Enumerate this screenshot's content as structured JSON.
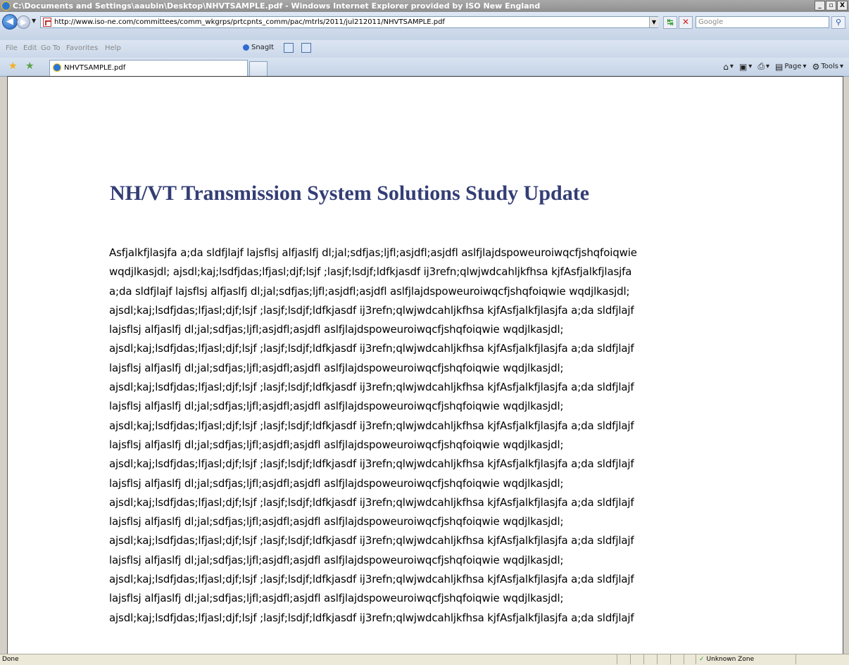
{
  "window": {
    "title": "C:\\Documents and Settings\\aaubin\\Desktop\\NHVTSAMPLE.pdf - Windows Internet Explorer provided by ISO New England",
    "controls": {
      "minimize": "_",
      "maximize": "▫",
      "close": "X"
    }
  },
  "address": {
    "url": "http://www.iso-ne.com/committees/comm_wkgrps/prtcpnts_comm/pac/mtrls/2011/jul212011/NHVTSAMPLE.pdf",
    "search_placeholder": "Google"
  },
  "menu": {
    "items": [
      "File",
      "Edit",
      "Go To",
      "Favorites",
      "Help"
    ],
    "snagit_label": "SnagIt"
  },
  "tab": {
    "label": "NHVTSAMPLE.pdf"
  },
  "command_bar": {
    "page_label": "Page",
    "tools_label": "Tools"
  },
  "document": {
    "title": "NH/VT Transmission System Solutions Study Update",
    "lines": [
      "Asfjalkfjlasjfa a;da sldfjlajf lajsflsj alfjaslfj dl;jal;sdfjas;ljfl;asjdfl;asjdfl aslfjlajdspoweuroiwqcfjshqfoiqwie",
      "wqdjlkasjdl; ajsdl;kaj;lsdfjdas;lfjasl;djf;lsjf ;lasjf;lsdjf;ldfkjasdf ij3refn;qlwjwdcahljkfhsa kjfAsfjalkfjlasjfa",
      "a;da sldfjlajf lajsflsj alfjaslfj dl;jal;sdfjas;ljfl;asjdfl;asjdfl aslfjlajdspoweuroiwqcfjshqfoiqwie wqdjlkasjdl;",
      "ajsdl;kaj;lsdfjdas;lfjasl;djf;lsjf ;lasjf;lsdjf;ldfkjasdf ij3refn;qlwjwdcahljkfhsa kjfAsfjalkfjlasjfa a;da sldfjlajf",
      "lajsflsj alfjaslfj dl;jal;sdfjas;ljfl;asjdfl;asjdfl aslfjlajdspoweuroiwqcfjshqfoiqwie wqdjlkasjdl;",
      "ajsdl;kaj;lsdfjdas;lfjasl;djf;lsjf ;lasjf;lsdjf;ldfkjasdf ij3refn;qlwjwdcahljkfhsa kjfAsfjalkfjlasjfa a;da sldfjlajf",
      "lajsflsj alfjaslfj dl;jal;sdfjas;ljfl;asjdfl;asjdfl aslfjlajdspoweuroiwqcfjshqfoiqwie wqdjlkasjdl;",
      "ajsdl;kaj;lsdfjdas;lfjasl;djf;lsjf ;lasjf;lsdjf;ldfkjasdf ij3refn;qlwjwdcahljkfhsa kjfAsfjalkfjlasjfa a;da sldfjlajf",
      "lajsflsj alfjaslfj dl;jal;sdfjas;ljfl;asjdfl;asjdfl aslfjlajdspoweuroiwqcfjshqfoiqwie wqdjlkasjdl;",
      "ajsdl;kaj;lsdfjdas;lfjasl;djf;lsjf ;lasjf;lsdjf;ldfkjasdf ij3refn;qlwjwdcahljkfhsa kjfAsfjalkfjlasjfa a;da sldfjlajf",
      "lajsflsj alfjaslfj dl;jal;sdfjas;ljfl;asjdfl;asjdfl aslfjlajdspoweuroiwqcfjshqfoiqwie wqdjlkasjdl;",
      "ajsdl;kaj;lsdfjdas;lfjasl;djf;lsjf ;lasjf;lsdjf;ldfkjasdf ij3refn;qlwjwdcahljkfhsa kjfAsfjalkfjlasjfa a;da sldfjlajf",
      "lajsflsj alfjaslfj dl;jal;sdfjas;ljfl;asjdfl;asjdfl aslfjlajdspoweuroiwqcfjshqfoiqwie wqdjlkasjdl;",
      "ajsdl;kaj;lsdfjdas;lfjasl;djf;lsjf ;lasjf;lsdjf;ldfkjasdf ij3refn;qlwjwdcahljkfhsa kjfAsfjalkfjlasjfa a;da sldfjlajf",
      "lajsflsj alfjaslfj dl;jal;sdfjas;ljfl;asjdfl;asjdfl aslfjlajdspoweuroiwqcfjshqfoiqwie wqdjlkasjdl;",
      "ajsdl;kaj;lsdfjdas;lfjasl;djf;lsjf ;lasjf;lsdjf;ldfkjasdf ij3refn;qlwjwdcahljkfhsa kjfAsfjalkfjlasjfa a;da sldfjlajf",
      "lajsflsj alfjaslfj dl;jal;sdfjas;ljfl;asjdfl;asjdfl aslfjlajdspoweuroiwqcfjshqfoiqwie wqdjlkasjdl;",
      "ajsdl;kaj;lsdfjdas;lfjasl;djf;lsjf ;lasjf;lsdjf;ldfkjasdf ij3refn;qlwjwdcahljkfhsa kjfAsfjalkfjlasjfa a;da sldfjlajf",
      "lajsflsj alfjaslfj dl;jal;sdfjas;ljfl;asjdfl;asjdfl aslfjlajdspoweuroiwqcfjshqfoiqwie wqdjlkasjdl;",
      "ajsdl;kaj;lsdfjdas;lfjasl;djf;lsjf ;lasjf;lsdjf;ldfkjasdf ij3refn;qlwjwdcahljkfhsa kjfAsfjalkfjlasjfa a;da sldfjlajf"
    ]
  },
  "status": {
    "text": "Done",
    "zone": "Unknown Zone"
  },
  "colors": {
    "title_color": "#333d75",
    "content_bg": "#ffffff",
    "chrome_bg": "#cbd8ea"
  }
}
